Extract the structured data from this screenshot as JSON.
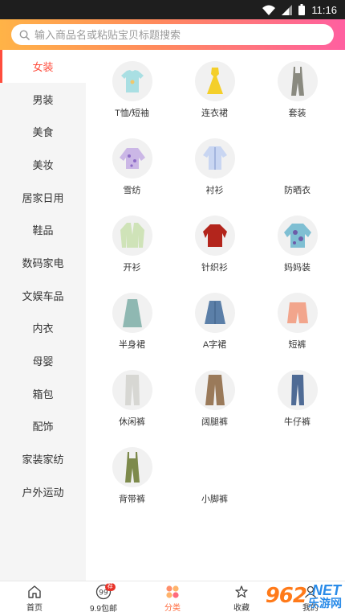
{
  "status_bar": {
    "time": "11:16"
  },
  "search": {
    "placeholder": "输入商品名或粘贴宝贝标题搜索"
  },
  "sidebar": {
    "items": [
      {
        "label": "女装",
        "active": true
      },
      {
        "label": "男装"
      },
      {
        "label": "美食"
      },
      {
        "label": "美妆"
      },
      {
        "label": "居家日用"
      },
      {
        "label": "鞋品"
      },
      {
        "label": "数码家电"
      },
      {
        "label": "文娱车品"
      },
      {
        "label": "内衣"
      },
      {
        "label": "母婴"
      },
      {
        "label": "箱包"
      },
      {
        "label": "配饰"
      },
      {
        "label": "家装家纺"
      },
      {
        "label": "户外运动"
      }
    ]
  },
  "grid": {
    "items": [
      {
        "label": "T恤/短袖",
        "icon": "tshirt-icon"
      },
      {
        "label": "连衣裙",
        "icon": "dress-icon"
      },
      {
        "label": "套装",
        "icon": "jumpsuit-set-icon"
      },
      {
        "label": "雪纺",
        "icon": "chiffon-blouse-icon"
      },
      {
        "label": "衬衫",
        "icon": "shirt-icon"
      },
      {
        "label": "防晒衣",
        "icon": ""
      },
      {
        "label": "开衫",
        "icon": "cardigan-icon"
      },
      {
        "label": "针织衫",
        "icon": "knit-sweater-icon"
      },
      {
        "label": "妈妈装",
        "icon": "mom-top-icon"
      },
      {
        "label": "半身裙",
        "icon": "long-skirt-icon"
      },
      {
        "label": "A字裙",
        "icon": "a-line-skirt-icon"
      },
      {
        "label": "短裤",
        "icon": "shorts-icon"
      },
      {
        "label": "休闲裤",
        "icon": "casual-pants-icon"
      },
      {
        "label": "阔腿裤",
        "icon": "wide-leg-pants-icon"
      },
      {
        "label": "牛仔裤",
        "icon": "jeans-icon"
      },
      {
        "label": "背带裤",
        "icon": "overalls-icon"
      },
      {
        "label": "小脚裤",
        "icon": ""
      }
    ]
  },
  "bottom_nav": {
    "items": [
      {
        "label": "首页",
        "icon": "home-icon"
      },
      {
        "label": "9.9包邮",
        "icon": "nine-nine-icon",
        "badge": "荐"
      },
      {
        "label": "分类",
        "icon": "category-icon",
        "active": true
      },
      {
        "label": "收藏",
        "icon": "favorite-icon"
      },
      {
        "label": "我的",
        "icon": "profile-icon"
      }
    ]
  },
  "watermark": {
    "number": "962",
    "net": ".NET",
    "site": "乐游网"
  },
  "colors": {
    "accent": "#ff4d3d",
    "nav_active": "#ff6a3d",
    "sidebar_bg": "#f5f5f5"
  }
}
